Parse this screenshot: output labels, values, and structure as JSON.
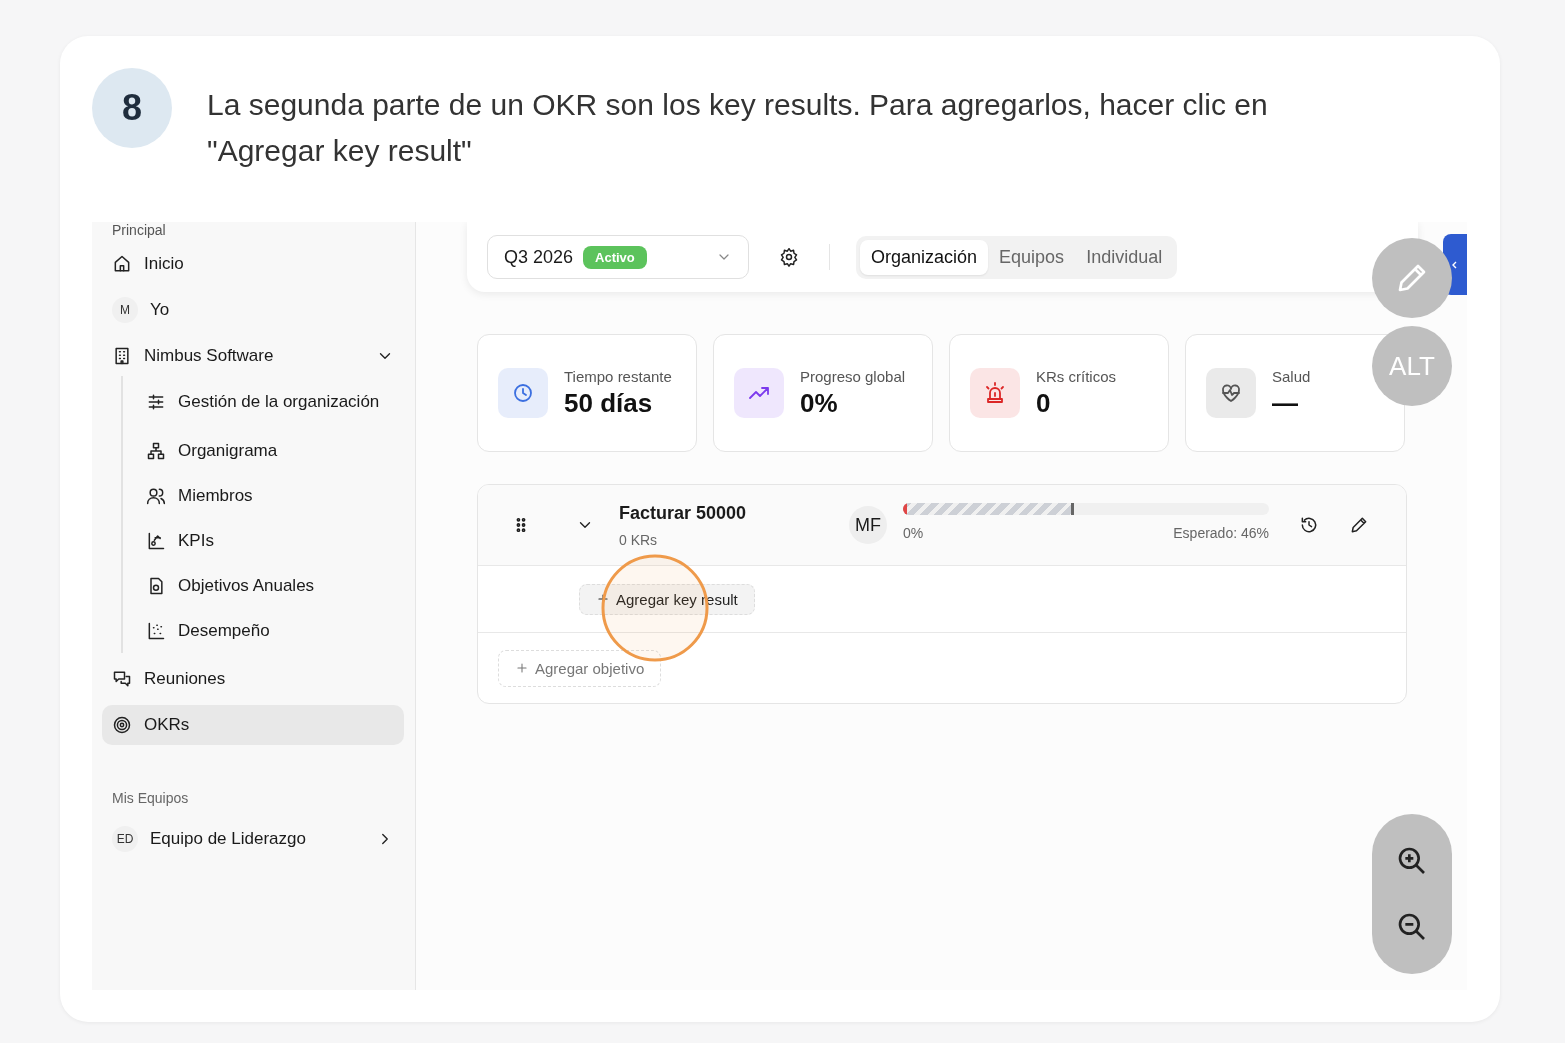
{
  "step": {
    "number": "8",
    "text": "La segunda parte de un OKR son los key results. Para agregarlos, hacer clic en \"Agregar key result\""
  },
  "sidebar": {
    "section_label": "Principal",
    "items": [
      {
        "kind": "icon",
        "label": "Inicio",
        "selected": false
      },
      {
        "kind": "avatar",
        "avatar": "M",
        "label": "Yo",
        "selected": false
      },
      {
        "kind": "icon",
        "label": "Nimbus Software",
        "selected": false,
        "expanded": true,
        "children": [
          {
            "label": "Gestión de la organización",
            "selected": false
          },
          {
            "label": "Organigrama",
            "selected": false
          },
          {
            "label": "Miembros",
            "selected": false
          },
          {
            "label": "KPIs",
            "selected": false
          },
          {
            "label": "Objetivos Anuales",
            "selected": false
          },
          {
            "label": "Desempeño",
            "selected": false
          }
        ]
      },
      {
        "kind": "icon",
        "label": "Reuniones",
        "selected": false
      },
      {
        "kind": "icon",
        "label": "OKRs",
        "selected": true
      }
    ],
    "teams_label": "Mis Equipos",
    "teams": [
      {
        "avatar": "ED",
        "label": "Equipo de Liderazgo",
        "expanded": false
      }
    ]
  },
  "topbar": {
    "period": {
      "value": "Q3 2026",
      "badge": "Activo"
    },
    "tabs": [
      {
        "label": "Organización",
        "selected": true
      },
      {
        "label": "Equipos",
        "selected": false
      },
      {
        "label": "Individual",
        "selected": false
      }
    ]
  },
  "stats": [
    {
      "label": "Tiempo restante",
      "value": "50 días",
      "color": "#3b6fe0"
    },
    {
      "label": "Progreso global",
      "value": "0%",
      "color": "#7c3aed"
    },
    {
      "label": "KRs críticos",
      "value": "0",
      "color": "#dc2626"
    },
    {
      "label": "Salud",
      "value": "—",
      "color": "#555555"
    }
  ],
  "objectives": [
    {
      "title": "Facturar 50000",
      "subtitle": "0 KRs",
      "owner": "MF",
      "expanded": true,
      "progress": {
        "label": "0%",
        "level": 0
      },
      "expected": {
        "label": "Esperado: 46%",
        "level": 0.46
      },
      "add_key_result": "Agregar key result"
    }
  ],
  "add_objective": "Agregar objetivo",
  "alt_button": "ALT"
}
